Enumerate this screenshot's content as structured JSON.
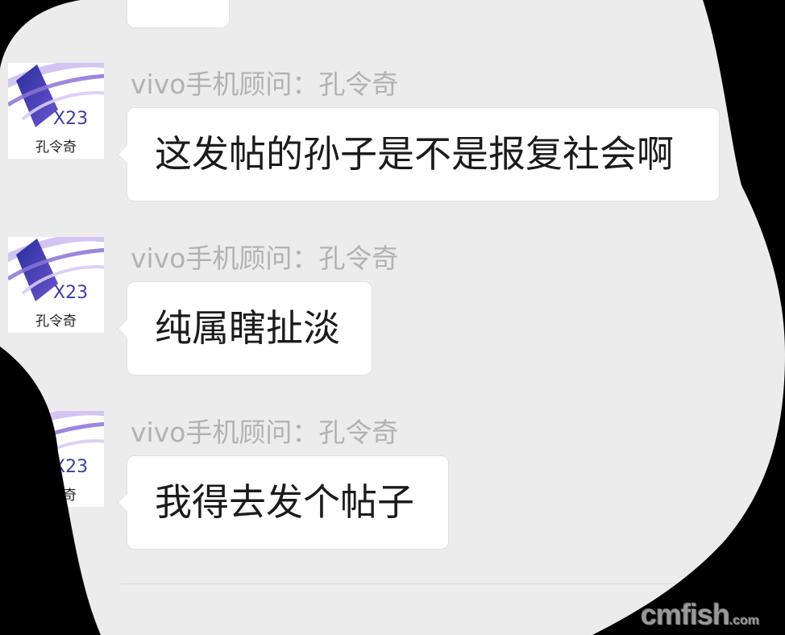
{
  "colors": {
    "page_bg": "#000000",
    "chat_bg": "#ececec",
    "bubble_bg": "#ffffff",
    "sender_text": "#b2b2b2",
    "avatar_accent": "#3b3fa3"
  },
  "avatar": {
    "badge": "X23",
    "label": "孔令奇"
  },
  "chat": {
    "messages": [
      {
        "sender": "vivo手机顾问：孔令奇",
        "text": "这发帖的孙子是不是报复社会啊"
      },
      {
        "sender": "vivo手机顾问：孔令奇",
        "text": "纯属瞎扯淡"
      },
      {
        "sender": "vivo手机顾问：孔令奇",
        "text": "我得去发个帖子"
      }
    ]
  },
  "watermark": {
    "brand": "cmfish",
    "suffix": ".com"
  }
}
